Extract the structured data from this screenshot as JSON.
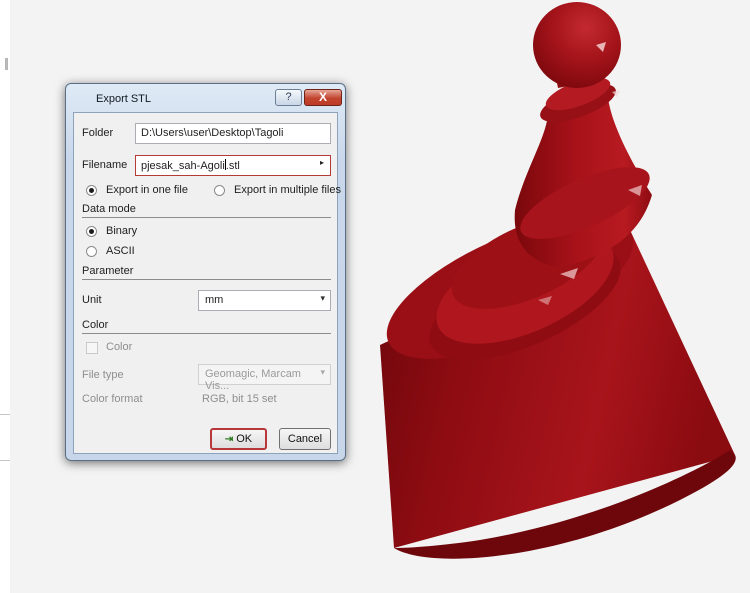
{
  "dialog": {
    "title": "Export STL",
    "help_glyph": "?",
    "close_glyph": "X",
    "folder_label": "Folder",
    "folder_value": "D:\\Users\\user\\Desktop\\Tagoli",
    "filename_label": "Filename",
    "filename_before_caret": "pjesak_sah-Agoli",
    "filename_after_caret": ".stl",
    "filename_arrow": "▸",
    "export_mode": {
      "one_file_label": "Export in one file",
      "one_file_selected": true,
      "multiple_label": "Export in multiple files",
      "multiple_selected": false
    },
    "data_mode": {
      "heading": "Data mode",
      "binary_label": "Binary",
      "binary_selected": true,
      "ascii_label": "ASCII",
      "ascii_selected": false
    },
    "parameter": {
      "heading": "Parameter",
      "unit_label": "Unit",
      "unit_value": "mm"
    },
    "color_section": {
      "heading": "Color",
      "color_checkbox_label": "Color",
      "color_checked": false,
      "file_type_label": "File type",
      "file_type_value": "Geomagic, Marcam Vis...",
      "color_format_label": "Color format",
      "color_format_value": "RGB, bit 15 set"
    },
    "ok_glyph": "⇥",
    "ok_label": "OK",
    "cancel_label": "Cancel"
  },
  "icons": {
    "dropdown": "▾"
  },
  "colors": {
    "model": "#9c0f14",
    "canvas_background": "#f3f3f3",
    "default_button_border": "#b8373a"
  }
}
